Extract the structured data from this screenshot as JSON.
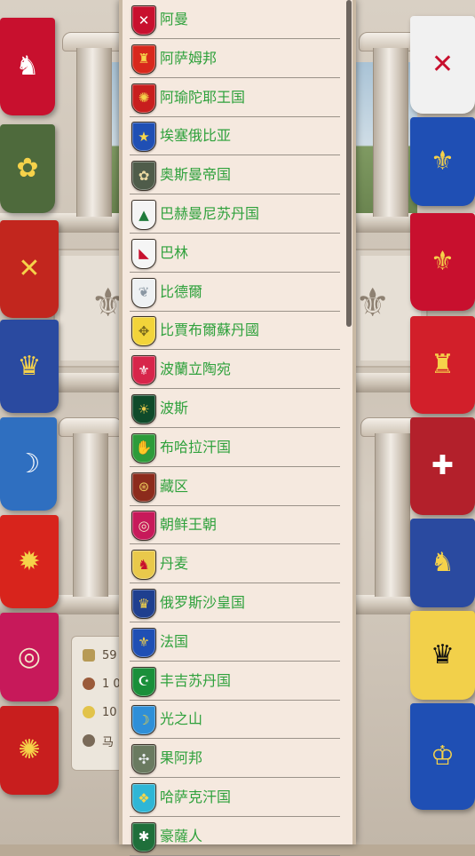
{
  "nations": [
    {
      "name": "阿曼",
      "icon": "oman-flag-icon",
      "bg": "#c8102e",
      "fg": "#ffffff",
      "glyph": "✕"
    },
    {
      "name": "阿萨姆邦",
      "icon": "assam-flag-icon",
      "bg": "#d8281c",
      "fg": "#f5d34a",
      "glyph": "♜"
    },
    {
      "name": "阿瑜陀耶王国",
      "icon": "ayutthaya-flag-icon",
      "bg": "#c81e1e",
      "fg": "#f5d34a",
      "glyph": "✺"
    },
    {
      "name": "埃塞俄比亚",
      "icon": "ethiopia-flag-icon",
      "bg": "#1f4fb4",
      "fg": "#f7d64a",
      "glyph": "★"
    },
    {
      "name": "奥斯曼帝国",
      "icon": "ottoman-flag-icon",
      "bg": "#4f5c4a",
      "fg": "#e9d9a2",
      "glyph": "✿"
    },
    {
      "name": "巴赫曼尼苏丹国",
      "icon": "bahmani-flag-icon",
      "bg": "#f4f4f4",
      "fg": "#1f7a3a",
      "glyph": "▲"
    },
    {
      "name": "巴林",
      "icon": "bahrain-flag-icon",
      "bg": "#f5f5f5",
      "fg": "#c8102e",
      "glyph": "◣"
    },
    {
      "name": "比德爾",
      "icon": "bidar-flag-icon",
      "bg": "#eef1f3",
      "fg": "#8a97a3",
      "glyph": "❦"
    },
    {
      "name": "比賈布爾蘇丹國",
      "icon": "bijapur-flag-icon",
      "bg": "#f2d43a",
      "fg": "#7a6a1c",
      "glyph": "✥"
    },
    {
      "name": "波蘭立陶宛",
      "icon": "poland-lithuania-flag-icon",
      "bg": "#d7254a",
      "fg": "#ffffff",
      "glyph": "⚜"
    },
    {
      "name": "波斯",
      "icon": "persia-flag-icon",
      "bg": "#0f4a2a",
      "fg": "#e9c94b",
      "glyph": "☀"
    },
    {
      "name": "布哈拉汗国",
      "icon": "bukhara-flag-icon",
      "bg": "#2d9b3a",
      "fg": "#f1f1f1",
      "glyph": "✋"
    },
    {
      "name": "藏区",
      "icon": "tibet-flag-icon",
      "bg": "#8c2b1c",
      "fg": "#e8c35a",
      "glyph": "⊛"
    },
    {
      "name": "朝鲜王朝",
      "icon": "joseon-flag-icon",
      "bg": "#c7195a",
      "fg": "#f3e9c9",
      "glyph": "◎"
    },
    {
      "name": "丹麦",
      "icon": "denmark-flag-icon",
      "bg": "#e9c94b",
      "fg": "#c8102e",
      "glyph": "♞"
    },
    {
      "name": "俄罗斯沙皇国",
      "icon": "russia-flag-icon",
      "bg": "#1f3f8f",
      "fg": "#f2d04a",
      "glyph": "♛"
    },
    {
      "name": "法国",
      "icon": "france-flag-icon",
      "bg": "#1f4fb4",
      "fg": "#f5d34a",
      "glyph": "⚜"
    },
    {
      "name": "丰吉苏丹国",
      "icon": "funj-flag-icon",
      "bg": "#1a8f3a",
      "fg": "#ffffff",
      "glyph": "☪"
    },
    {
      "name": "光之山",
      "icon": "koh-i-noor-flag-icon",
      "bg": "#2f8fd8",
      "fg": "#f4d23a",
      "glyph": "☽"
    },
    {
      "name": "果阿邦",
      "icon": "goa-flag-icon",
      "bg": "#6a7a60",
      "fg": "#e9ecef",
      "glyph": "✣"
    },
    {
      "name": "哈萨克汗国",
      "icon": "kazakh-flag-icon",
      "bg": "#2fb6d6",
      "fg": "#f7d64a",
      "glyph": "❖"
    },
    {
      "name": "豪薩人",
      "icon": "hausa-flag-icon",
      "bg": "#1f6f3a",
      "fg": "#ffffff",
      "glyph": "✱"
    }
  ],
  "stats": [
    {
      "value": "59",
      "icon": "gold-icon"
    },
    {
      "value": "1 0",
      "icon": "power-icon"
    },
    {
      "value": "10",
      "icon": "coin-icon"
    },
    {
      "value": "马",
      "icon": "horse-icon"
    }
  ]
}
